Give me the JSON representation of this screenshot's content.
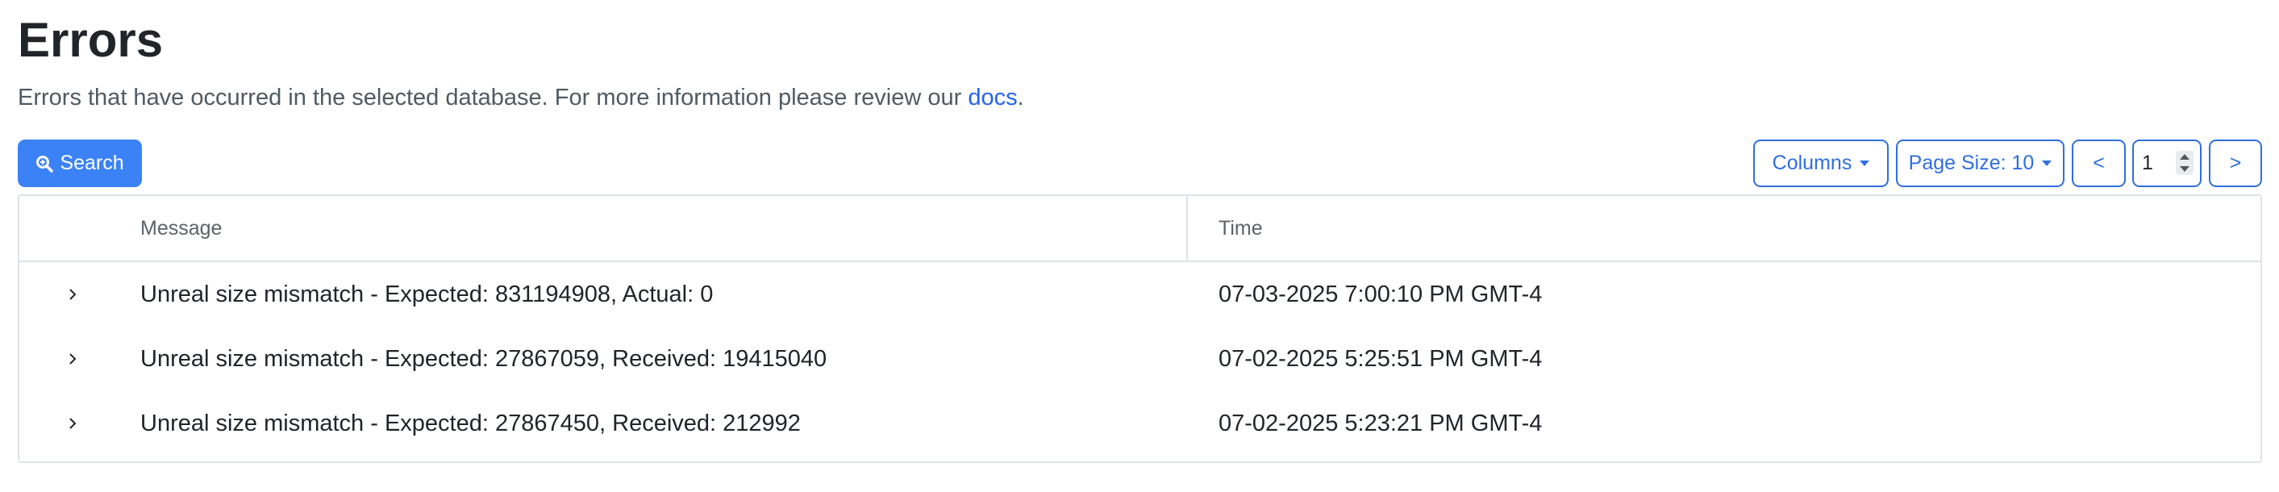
{
  "header": {
    "title": "Errors",
    "subtitle_text": "Errors that have occurred in the selected database. For more information please review our",
    "subtitle_link": "docs",
    "subtitle_end": "."
  },
  "toolbar": {
    "search_label": "Search",
    "columns_label": "Columns",
    "page_size_label": "Page Size: 10",
    "prev_label": "<",
    "next_label": ">",
    "page_value": "1"
  },
  "table": {
    "headers": [
      "Message",
      "Time"
    ],
    "rows": [
      {
        "message": "Unreal size mismatch - Expected: 831194908, Actual: 0",
        "time": "07-03-2025 7:00:10 PM GMT-4"
      },
      {
        "message": "Unreal size mismatch - Expected: 27867059, Received: 19415040",
        "time": "07-02-2025 5:25:51 PM GMT-4"
      },
      {
        "message": "Unreal size mismatch - Expected: 27867450, Received: 212992",
        "time": "07-02-2025 5:23:21 PM GMT-4"
      }
    ]
  },
  "colors": {
    "primary": "#3b82f6",
    "outline": "#2f6fe0",
    "link": "#2563eb",
    "border": "#dee2e6"
  },
  "icons": {
    "search": "search-icon",
    "row_expand": "chevron-right-icon",
    "dropdown": "caret-down-icon"
  }
}
